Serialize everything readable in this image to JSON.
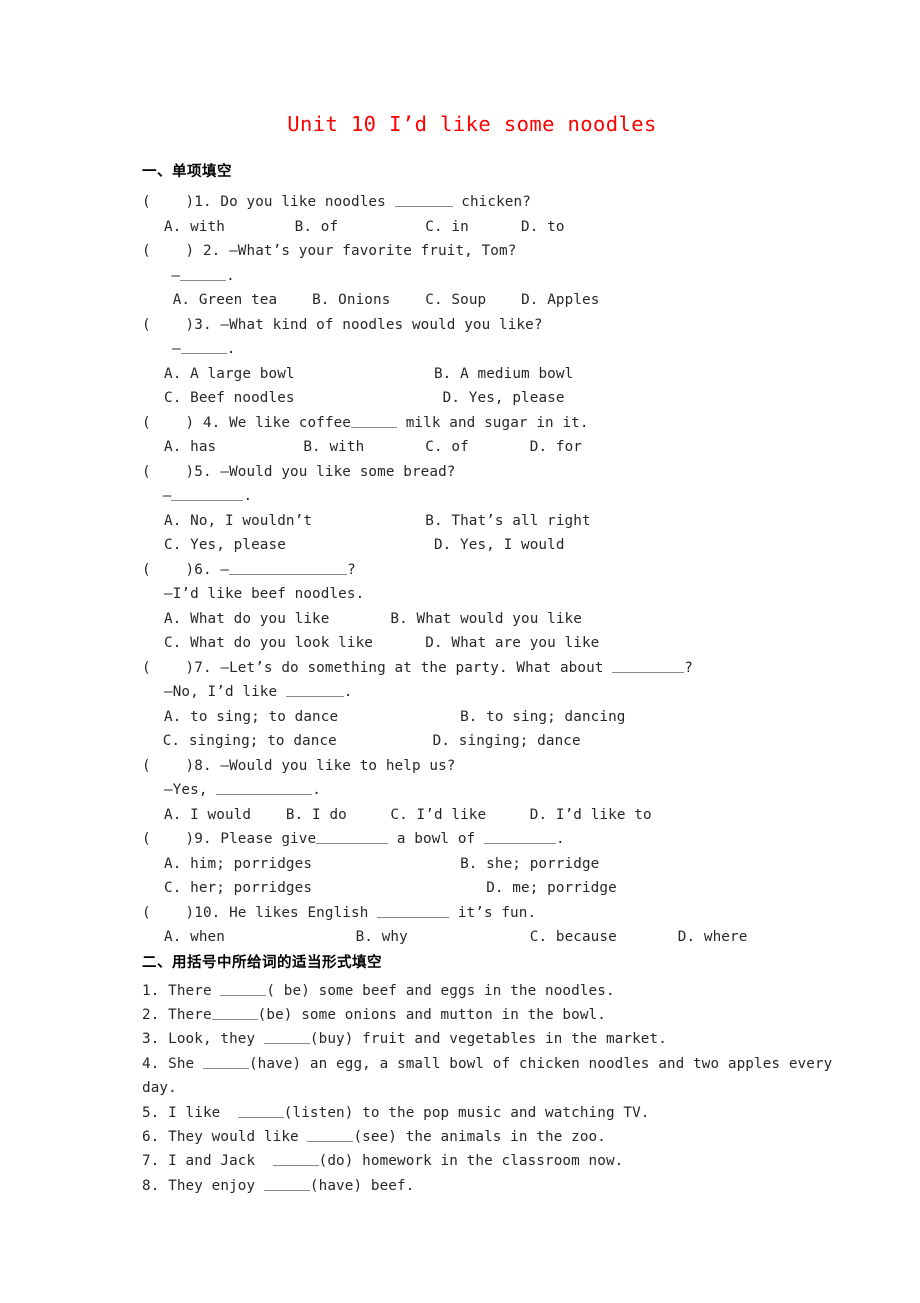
{
  "document": {
    "title": "Unit 10 I’d like some noodles",
    "title_color": "#ff0000"
  },
  "section_one": {
    "heading": "一、单项填空",
    "questions": [
      {
        "marker": "(    )1.",
        "stem_before": " Do you like noodles ",
        "stem_after": " chicken?",
        "options_rows": [
          [
            "A. with",
            "B. of",
            "C. in",
            "D. to"
          ]
        ]
      },
      {
        "marker": "(    ) 2.",
        "stem": " —What’s your favorite fruit, Tom?",
        "answer_prefix": "—",
        "answer_suffix": ".",
        "options_rows": [
          [
            "A. Green tea",
            "B. Onions",
            "C. Soup",
            "D. Apples"
          ]
        ]
      },
      {
        "marker": "(    )3.",
        "stem": " —What kind of noodles would you like?",
        "answer_prefix": "—",
        "answer_suffix": ".",
        "options_rows": [
          [
            "A. A large bowl",
            "B. A medium bowl"
          ],
          [
            "C. Beef noodles",
            "D. Yes, please"
          ]
        ]
      },
      {
        "marker": "(    ) 4.",
        "stem_before": " We like coffee",
        "stem_after": " milk and sugar in it.",
        "options_rows": [
          [
            "A. has",
            "B. with",
            "C. of",
            "D. for"
          ]
        ]
      },
      {
        "marker": "(    )5.",
        "stem": " —Would you like some bread?",
        "answer_prefix": "—",
        "answer_suffix": ".",
        "options_rows": [
          [
            "A. No, I wouldn’t",
            "B. That’s all right"
          ],
          [
            "C. Yes, please",
            "D. Yes, I would"
          ]
        ]
      },
      {
        "marker": "(    )6.",
        "stem_before": " —",
        "stem_after": "?",
        "reply": "—I’d like beef noodles.",
        "options_rows": [
          [
            "A. What do you like",
            "B. What would you like"
          ],
          [
            "C. What do you look like",
            "D. What are you like"
          ]
        ]
      },
      {
        "marker": "(    )7.",
        "stem_before": " —Let’s do something at the party. What about ",
        "stem_after": "?",
        "reply_before": "—No, I’d like ",
        "reply_after": ".",
        "options_rows": [
          [
            "A. to sing; to dance",
            "B. to sing; dancing"
          ],
          [
            "C. singing; to dance",
            "D. singing; dance"
          ]
        ]
      },
      {
        "marker": "(    )8.",
        "stem": " —Would you like to help us?",
        "reply_before": "—Yes, ",
        "reply_after": ".",
        "options_rows": [
          [
            "A. I would",
            "B. I do",
            "C. I’d like",
            "D. I’d like to"
          ]
        ]
      },
      {
        "marker": "(    )9.",
        "stem_before": " Please give",
        "stem_mid": " a bowl of ",
        "stem_after": ".",
        "options_rows": [
          [
            "A. him; porridges",
            "B. she; porridge"
          ],
          [
            "C. her; porridges",
            "D. me; porridge"
          ]
        ]
      },
      {
        "marker": "(    )10.",
        "stem_before": " He likes English ",
        "stem_after": " it’s fun.",
        "options_rows": [
          [
            "A. when",
            "B. why",
            "C. because",
            "D. where"
          ]
        ]
      }
    ]
  },
  "section_two": {
    "heading": "二、用括号中所给词的适当形式填空",
    "items": [
      {
        "num": "1.",
        "before": " There ",
        "after": "( be) some beef and eggs in the noodles."
      },
      {
        "num": "2.",
        "before": " There",
        "after": "(be) some onions and mutton in the bowl."
      },
      {
        "num": "3.",
        "before": " Look, they ",
        "after": "(buy) fruit and vegetables in the market."
      },
      {
        "num": "4.",
        "before": " She ",
        "after": "(have) an egg, a small bowl of chicken noodles and two apples every day."
      },
      {
        "num": "5.",
        "before": " I like  ",
        "after": "(listen) to the pop music and watching TV."
      },
      {
        "num": "6.",
        "before": " They would like ",
        "after": "(see) the animals in the zoo."
      },
      {
        "num": "7.",
        "before": " I and Jack  ",
        "after": "(do) homework in the classroom now."
      },
      {
        "num": "8.",
        "before": " They enjoy ",
        "after": "(have) beef."
      }
    ]
  }
}
